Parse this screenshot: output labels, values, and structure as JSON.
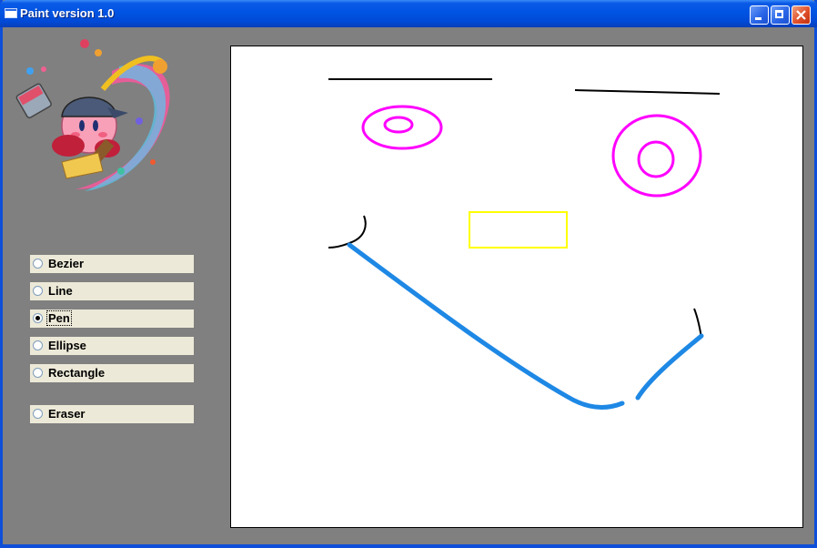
{
  "window": {
    "title": "Paint version 1.0"
  },
  "titlebar_buttons": [
    "minimize",
    "maximize",
    "close"
  ],
  "tools": [
    {
      "label": "Bezier",
      "checked": false
    },
    {
      "label": "Line",
      "checked": false
    },
    {
      "label": "Pen",
      "checked": true
    },
    {
      "label": "Ellipse",
      "checked": false
    },
    {
      "label": "Rectangle",
      "checked": false
    },
    {
      "label": "Eraser",
      "checked": false
    }
  ],
  "logo": {
    "icon": "kirby-painter-logo"
  },
  "canvas": {
    "shapes": [
      {
        "type": "line",
        "color": "#000000"
      },
      {
        "type": "line",
        "color": "#000000"
      },
      {
        "type": "ellipse",
        "color": "#ff00ff"
      },
      {
        "type": "ellipse",
        "color": "#ff00ff"
      },
      {
        "type": "ellipse",
        "color": "#ff00ff"
      },
      {
        "type": "ellipse",
        "color": "#ff00ff"
      },
      {
        "type": "rectangle",
        "color": "#ffff00"
      },
      {
        "type": "bezier",
        "color": "#000000"
      },
      {
        "type": "bezier",
        "color": "#000000"
      },
      {
        "type": "pen",
        "color": "#1e88e5"
      },
      {
        "type": "pen",
        "color": "#1e88e5"
      }
    ]
  }
}
